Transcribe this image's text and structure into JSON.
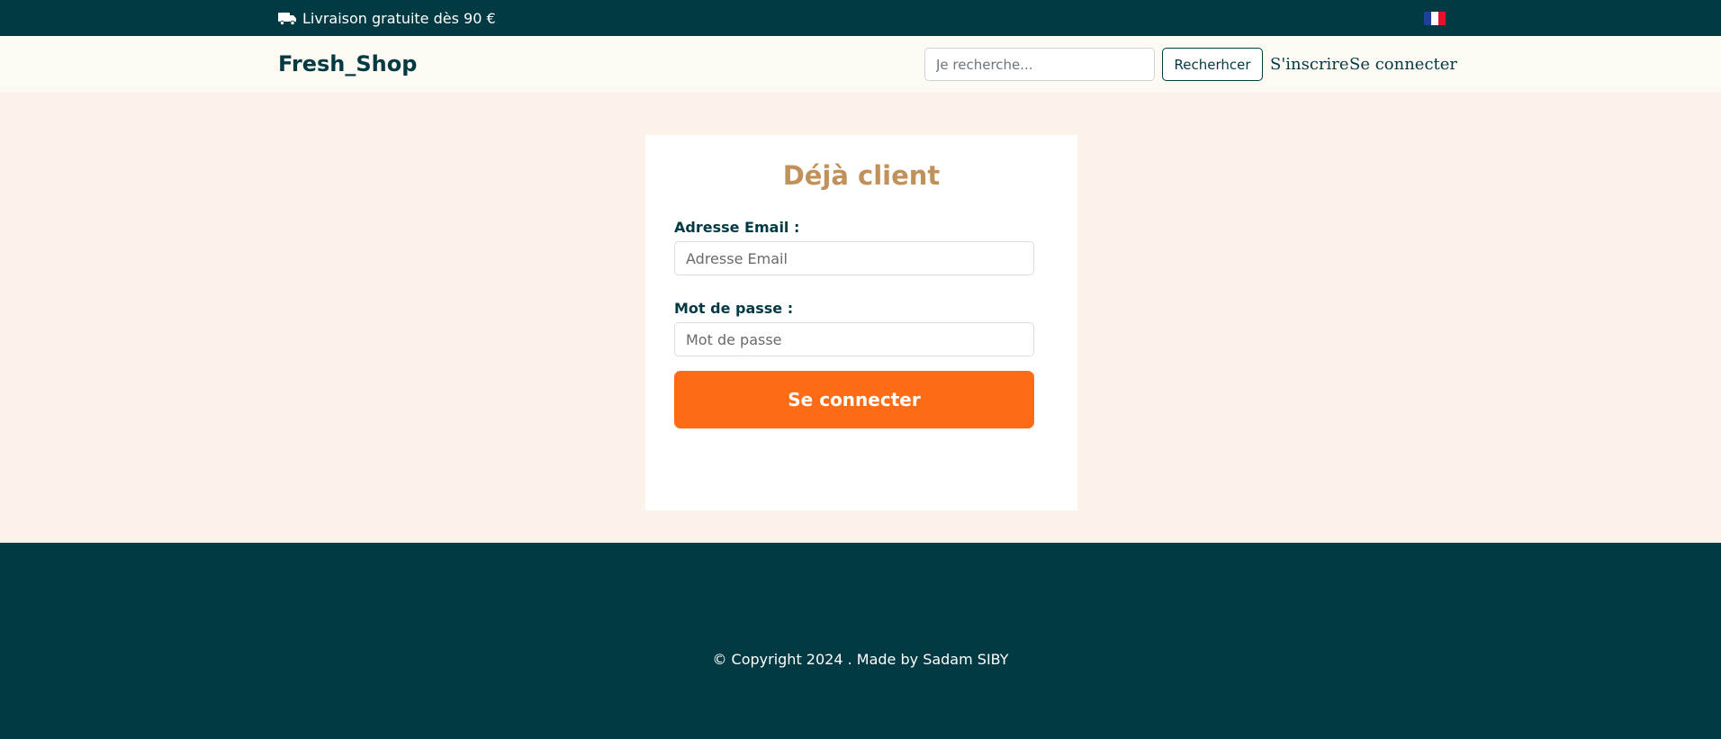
{
  "topbar": {
    "promo_text": "Livraison gratuite dès 90 €",
    "promo_icon": "truck-icon",
    "language_icon": "french-flag-icon"
  },
  "header": {
    "brand": "Fresh_Shop",
    "search": {
      "placeholder": "Je recherche...",
      "value": ""
    },
    "search_button": "Recherhcer",
    "nav": {
      "register": "S'inscrire",
      "login": "Se connecter"
    }
  },
  "login_form": {
    "title": "Déjà client",
    "email_label": "Adresse Email :",
    "email_placeholder": "Adresse Email",
    "email_value": "",
    "password_label": "Mot de passe :",
    "password_placeholder": "Mot de passe",
    "password_value": "",
    "submit": "Se connecter"
  },
  "footer": {
    "copyright": "© Copyright 2024 . Made by Sadam SIBY"
  },
  "colors": {
    "primary_dark": "#023a44",
    "accent_orange": "#fe6b15",
    "title_gold": "#c0915a",
    "page_bg": "#fbf3ea"
  }
}
